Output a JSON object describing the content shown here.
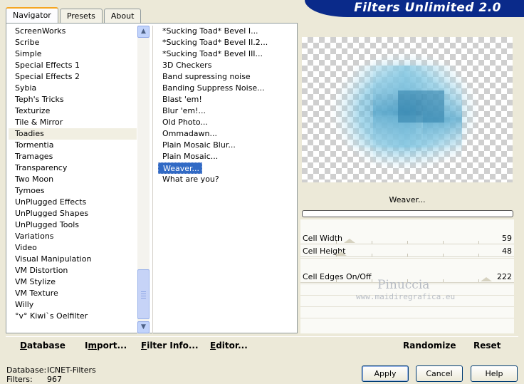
{
  "tabs": [
    {
      "label": "Navigator",
      "active": true
    },
    {
      "label": "Presets",
      "active": false
    },
    {
      "label": "About",
      "active": false
    }
  ],
  "banner": {
    "title": "Filters Unlimited 2.0",
    "color": "#0a2a8a"
  },
  "categories": [
    {
      "label": "ScreenWorks"
    },
    {
      "label": "Scribe"
    },
    {
      "label": "Simple"
    },
    {
      "label": "Special Effects 1"
    },
    {
      "label": "Special Effects 2"
    },
    {
      "label": "Sybia"
    },
    {
      "label": "Teph's Tricks"
    },
    {
      "label": "Texturize"
    },
    {
      "label": "Tile & Mirror"
    },
    {
      "label": "Toadies",
      "highlighted": true
    },
    {
      "label": "Tormentia"
    },
    {
      "label": "Tramages"
    },
    {
      "label": "Transparency"
    },
    {
      "label": "Two Moon"
    },
    {
      "label": "Tymoes"
    },
    {
      "label": "UnPlugged Effects"
    },
    {
      "label": "UnPlugged Shapes"
    },
    {
      "label": "UnPlugged Tools"
    },
    {
      "label": "Variations"
    },
    {
      "label": "Video"
    },
    {
      "label": "Visual Manipulation"
    },
    {
      "label": "VM Distortion"
    },
    {
      "label": "VM Stylize"
    },
    {
      "label": "VM Texture"
    },
    {
      "label": "Willy"
    },
    {
      "label": "°v° Kiwi`s Oelfilter"
    }
  ],
  "filters": [
    {
      "label": "*Sucking Toad*  Bevel I..."
    },
    {
      "label": "*Sucking Toad*  Bevel II.2..."
    },
    {
      "label": "*Sucking Toad*  Bevel III..."
    },
    {
      "label": "3D Checkers"
    },
    {
      "label": "Band supressing noise"
    },
    {
      "label": "Banding Suppress Noise..."
    },
    {
      "label": "Blast 'em!"
    },
    {
      "label": "Blur 'em!..."
    },
    {
      "label": "Old Photo..."
    },
    {
      "label": "Ommadawn..."
    },
    {
      "label": "Plain Mosaic Blur..."
    },
    {
      "label": "Plain Mosaic..."
    },
    {
      "label": "Weaver...",
      "selected": true
    },
    {
      "label": "What are you?"
    }
  ],
  "selected_filter": "Weaver...",
  "progress": 0,
  "params": [
    {
      "label": "Cell Width",
      "value": "59",
      "fraction": 0.23
    },
    {
      "label": "Cell Height",
      "value": "48",
      "fraction": 0.19
    },
    {
      "label": "Cell Edges On/Off",
      "value": "222",
      "fraction": 0.87
    }
  ],
  "watermark": {
    "name": "Pinuccia",
    "url": "www.maidiregrafica.eu"
  },
  "bottom_buttons": {
    "database": {
      "u": "D",
      "rest": "atabase"
    },
    "import": {
      "pre": "I",
      "u": "m",
      "rest": "port..."
    },
    "filter_info": {
      "u": "F",
      "rest": "ilter Info..."
    },
    "editor": {
      "u": "E",
      "rest": "ditor..."
    },
    "randomize": "Randomize",
    "reset": "Reset"
  },
  "status": {
    "database_label": "Database:",
    "database_value": "ICNET-Filters",
    "filters_label": "Filters:",
    "filters_value": "967"
  },
  "dialog_buttons": {
    "apply": "Apply",
    "cancel": "Cancel",
    "help": "Help"
  },
  "colors": {
    "selection": "#316ac5",
    "weave_dark": "#5aa3c4",
    "weave_light": "#c9ecf7"
  }
}
